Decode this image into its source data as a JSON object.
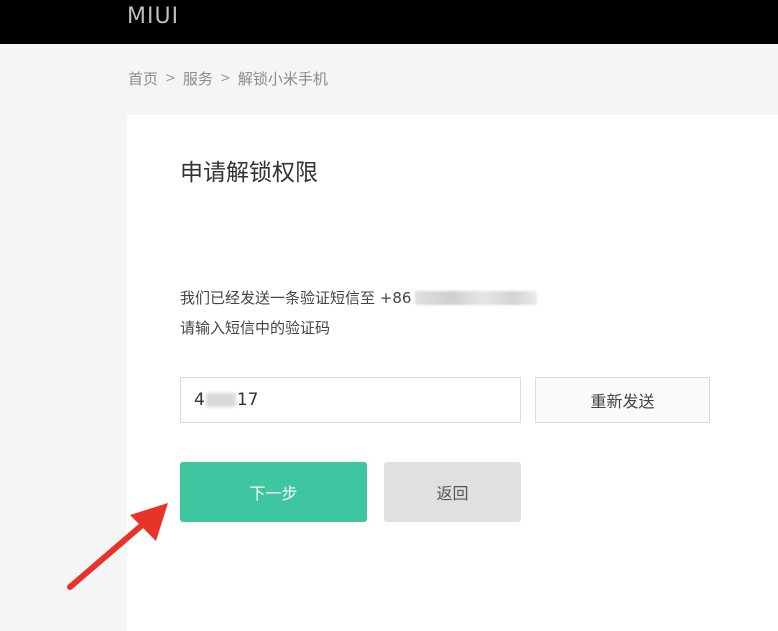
{
  "header": {
    "logo": "MIUI"
  },
  "breadcrumb": {
    "home": "首页",
    "sep": ">",
    "services": "服务",
    "current": "解锁小米手机"
  },
  "card": {
    "title": "申请解锁权限",
    "sent_message": "我们已经发送一条验证短信至 +86",
    "prompt": "请输入短信中的验证码",
    "code_prefix": "4",
    "code_suffix": "17",
    "resend_label": "重新发送",
    "next_label": "下一步",
    "back_label": "返回"
  },
  "colors": {
    "accent": "#3ec6a0",
    "arrow": "#e8332a",
    "topbar": "#000000"
  }
}
